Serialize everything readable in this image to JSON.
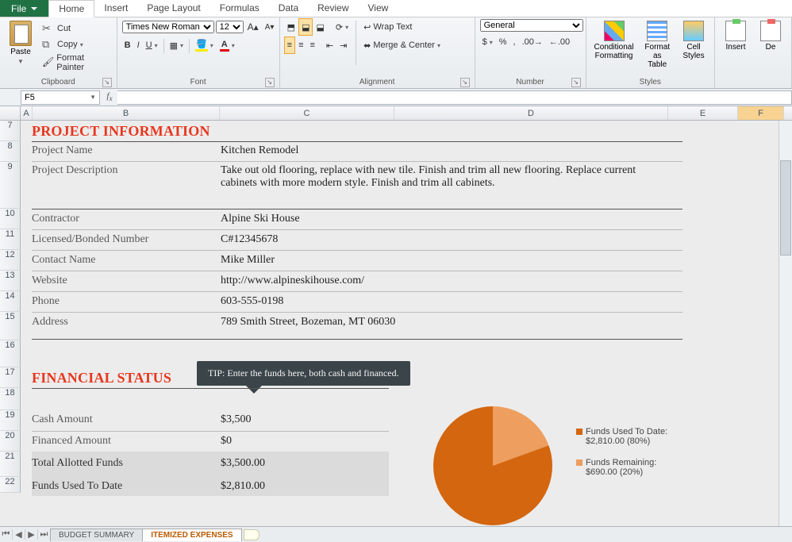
{
  "tabs": {
    "file": "File",
    "home": "Home",
    "insert": "Insert",
    "pageLayout": "Page Layout",
    "formulas": "Formulas",
    "data": "Data",
    "review": "Review",
    "view": "View"
  },
  "ribbon": {
    "clipboard": {
      "label": "Clipboard",
      "paste": "Paste",
      "cut": "Cut",
      "copy": "Copy",
      "formatPainter": "Format Painter"
    },
    "font": {
      "label": "Font",
      "name": "Times New Roman",
      "size": "12"
    },
    "alignment": {
      "label": "Alignment",
      "wrap": "Wrap Text",
      "merge": "Merge & Center"
    },
    "number": {
      "label": "Number",
      "format": "General"
    },
    "styles": {
      "label": "Styles",
      "cond": "Conditional Formatting",
      "fmt": "Format as Table",
      "cell": "Cell Styles"
    },
    "cells": {
      "ins": "Insert",
      "del": "De"
    }
  },
  "nameBox": "F5",
  "columns": {
    "A": "A",
    "B": "B",
    "C": "C",
    "D": "D",
    "E": "E",
    "F": "F"
  },
  "rows": [
    "7",
    "8",
    "9",
    "10",
    "11",
    "12",
    "13",
    "14",
    "15",
    "16",
    "17",
    "18",
    "19",
    "20",
    "21",
    "22"
  ],
  "doc": {
    "section1": "PROJECT INFORMATION",
    "projectNameL": "Project Name",
    "projectName": "Kitchen Remodel",
    "projectDescL": "Project Description",
    "projectDesc": "Take out old flooring, replace with new tile.  Finish and trim all new flooring.  Replace current cabinets with more modern style.  Finish and trim all cabinets.",
    "contractorL": "Contractor",
    "contractor": "Alpine Ski House",
    "licenseL": "Licensed/Bonded Number",
    "license": "C#12345678",
    "contactL": "Contact Name",
    "contact": "Mike Miller",
    "websiteL": "Website",
    "website": "http://www.alpineskihouse.com/",
    "phoneL": "Phone",
    "phone": "603-555-0198",
    "addressL": "Address",
    "address": "789 Smith Street, Bozeman, MT 06030",
    "section2": "FINANCIAL STATUS",
    "tip": "TIP:  Enter the funds here, both cash and financed.",
    "cashL": "Cash Amount",
    "cash": "$3,500",
    "finL": "Financed Amount",
    "fin": "$0",
    "totalL": "Total Allotted Funds",
    "total": "$3,500.00",
    "usedL": "Funds Used To Date",
    "used": "$2,810.00",
    "legend1a": "Funds Used To Date:",
    "legend1b": "$2,810.00 (80%)",
    "legend2a": "Funds Remaining:",
    "legend2b": "$690.00 (20%)"
  },
  "sheets": {
    "s1": "BUDGET SUMMARY",
    "s2": "ITEMIZED EXPENSES"
  },
  "chart_data": {
    "type": "pie",
    "title": "",
    "series": [
      {
        "name": "Funds Used To Date",
        "value": 2810.0,
        "pct": 80,
        "color": "#d3660f"
      },
      {
        "name": "Funds Remaining",
        "value": 690.0,
        "pct": 20,
        "color": "#ee9e5e"
      }
    ]
  }
}
